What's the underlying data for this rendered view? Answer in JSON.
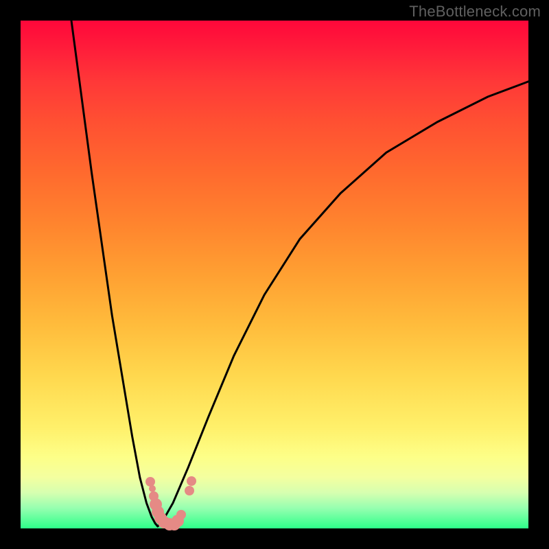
{
  "watermark": "TheBottleneck.com",
  "colors": {
    "frame": "#000000",
    "curve": "#000000",
    "marker": "#e58a85",
    "gradient_top": "#ff073a",
    "gradient_mid": "#ffbc3c",
    "gradient_bottom": "#2dff8a"
  },
  "chart_data": {
    "type": "line",
    "title": "",
    "xlabel": "",
    "ylabel": "",
    "xlim": [
      0,
      100
    ],
    "ylim": [
      0,
      100
    ],
    "series": [
      {
        "name": "left-curve",
        "x": [
          10,
          12,
          14,
          16,
          18,
          20,
          22,
          23.5,
          24.8,
          25.8,
          26.5,
          27.0
        ],
        "y": [
          100,
          85,
          70,
          56,
          42,
          30,
          18,
          10,
          5,
          2.3,
          1.0,
          0.4
        ]
      },
      {
        "name": "right-curve",
        "x": [
          27.0,
          28,
          30,
          33,
          37,
          42,
          48,
          55,
          63,
          72,
          82,
          92,
          100
        ],
        "y": [
          0.4,
          1.5,
          5,
          12,
          22,
          34,
          46,
          57,
          66,
          74,
          80,
          85,
          88
        ]
      }
    ],
    "markers": [
      {
        "x": 25.6,
        "y": 9.2,
        "size": "med"
      },
      {
        "x": 25.9,
        "y": 7.8,
        "size": "sm"
      },
      {
        "x": 26.2,
        "y": 6.4,
        "size": "med"
      },
      {
        "x": 26.6,
        "y": 4.7,
        "size": "big"
      },
      {
        "x": 27.0,
        "y": 3.2,
        "size": "big"
      },
      {
        "x": 27.5,
        "y": 2.0,
        "size": "big"
      },
      {
        "x": 28.3,
        "y": 1.2,
        "size": "big"
      },
      {
        "x": 29.3,
        "y": 0.8,
        "size": "big"
      },
      {
        "x": 30.3,
        "y": 0.8,
        "size": "big"
      },
      {
        "x": 31.0,
        "y": 1.5,
        "size": "big"
      },
      {
        "x": 31.6,
        "y": 2.7,
        "size": "med"
      },
      {
        "x": 33.2,
        "y": 7.5,
        "size": "med"
      },
      {
        "x": 33.7,
        "y": 9.3,
        "size": "med"
      }
    ]
  }
}
